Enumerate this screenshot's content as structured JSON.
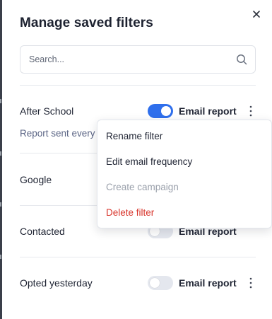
{
  "panel": {
    "title": "Manage saved filters",
    "close_icon": "close-icon"
  },
  "search": {
    "placeholder": "Search...",
    "value": "",
    "icon": "search-icon"
  },
  "filters": [
    {
      "name": "After School",
      "email_report_on": true,
      "email_label": "Email report",
      "subtitle": "Report sent every"
    },
    {
      "name": "Google"
    },
    {
      "name": "Contacted",
      "email_report_on": false,
      "email_label": "Email report"
    },
    {
      "name": "Opted yesterday",
      "email_report_on": false,
      "email_label": "Email report"
    }
  ],
  "context_menu": {
    "items": [
      {
        "label": "Rename filter",
        "state": "normal"
      },
      {
        "label": "Edit email frequency",
        "state": "normal"
      },
      {
        "label": "Create campaign",
        "state": "disabled"
      },
      {
        "label": "Delete filter",
        "state": "danger"
      }
    ]
  },
  "colors": {
    "toggle_on": "#2f6fec",
    "toggle_off": "#e4e7ee",
    "danger": "#d8352c",
    "disabled": "#9aa0ab",
    "subtitle": "#5b6585"
  }
}
